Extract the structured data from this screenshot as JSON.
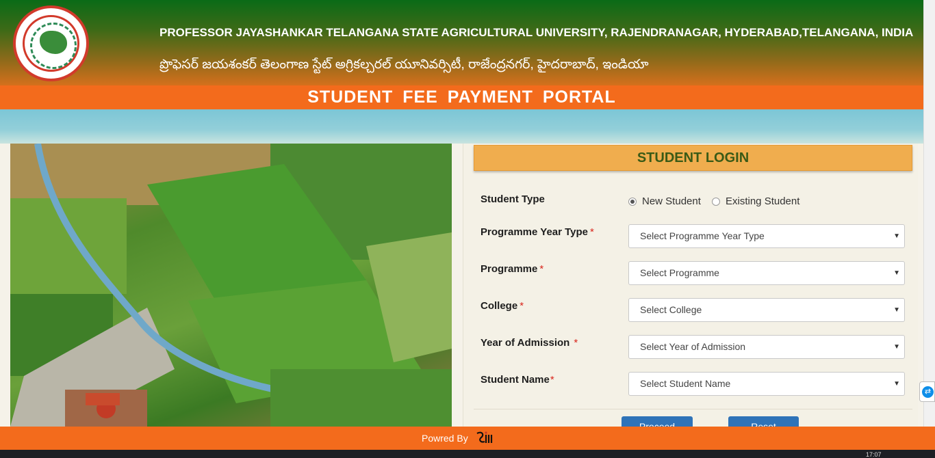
{
  "header": {
    "university_en": "PROFESSOR JAYASHANKAR TELANGANA STATE AGRICULTURAL UNIVERSITY, RAJENDRANAGAR, HYDERABAD,TELANGANA, INDIA",
    "university_te": "ప్రొఫెసర్ జయశంకర్ తెలంగాణ స్టేట్ అగ్రికల్చరల్ యూనివర్సిటీ, రాజేంద్రనగర్, హైదరాబాద్, ఇండియా",
    "portal_title": "STUDENT  FEE  PAYMENT  PORTAL"
  },
  "login": {
    "heading": "STUDENT LOGIN",
    "student_type_label": "Student Type",
    "student_type_options": [
      "New Student",
      "Existing Student"
    ],
    "student_type_selected": "New Student",
    "fields": [
      {
        "label": "Programme Year Type",
        "required": "*",
        "placeholder": "Select Programme Year Type"
      },
      {
        "label": "Programme",
        "required": "*",
        "placeholder": "Select Programme"
      },
      {
        "label": "College",
        "required": "*",
        "placeholder": "Select College"
      },
      {
        "label": "Year of Admission",
        "required": "*",
        "placeholder": "Select Year of Admission"
      },
      {
        "label": "Student Name",
        "required": "*",
        "placeholder": "Select Student Name"
      }
    ],
    "proceed_label": "Proceed",
    "reset_label": "Reset"
  },
  "footer": {
    "powered_by": "Powred By"
  },
  "taskbar": {
    "clock": "17:07"
  },
  "colors": {
    "header_top": "#0a6b17",
    "orange_bar": "#f36b1c",
    "login_heading_bg": "#f0ad4e",
    "button_blue": "#2f73b8"
  }
}
